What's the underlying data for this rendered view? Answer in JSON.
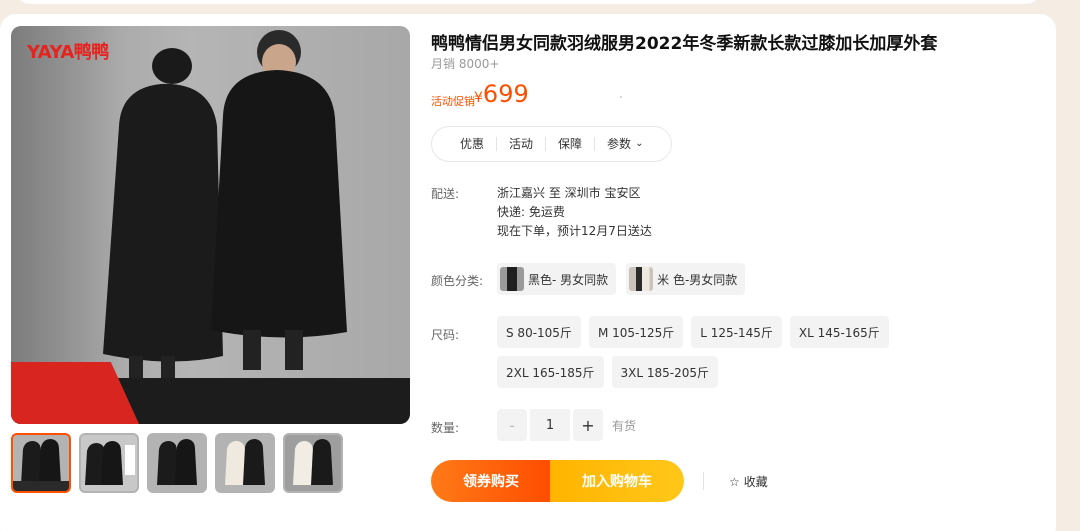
{
  "product": {
    "title": "鸭鸭情侣男女同款羽绒服男2022年冬季新款长款过膝加长加厚外套",
    "sales": "月销 8000+",
    "promo_label": "活动促销",
    "currency": "¥",
    "price": "699",
    "brand_logo": "YAYA鸭鸭"
  },
  "tabs": [
    {
      "label": "优惠"
    },
    {
      "label": "活动"
    },
    {
      "label": "保障"
    },
    {
      "label": "参数"
    }
  ],
  "shipping": {
    "label": "配送:",
    "route": "浙江嘉兴 至 深圳市 宝安区",
    "express": "快递: 免运费",
    "eta": "现在下单，预计12月7日送达"
  },
  "color": {
    "label": "颜色分类:",
    "options": [
      {
        "label": "黑色- 男女同款"
      },
      {
        "label": "米 色-男女同款"
      }
    ]
  },
  "size": {
    "label": "尺码:",
    "options": [
      {
        "label": "S 80-105斤"
      },
      {
        "label": "M 105-125斤"
      },
      {
        "label": "L 125-145斤"
      },
      {
        "label": "XL 145-165斤"
      },
      {
        "label": "2XL 165-185斤"
      },
      {
        "label": "3XL 185-205斤"
      }
    ]
  },
  "quantity": {
    "label": "数量:",
    "minus": "-",
    "value": "1",
    "plus": "+",
    "stock": "有货"
  },
  "actions": {
    "buy": "领券购买",
    "cart": "加入购物车",
    "favorite": "收藏"
  },
  "thumbnails_count": 5,
  "colors": {
    "accent": "#ff5000",
    "buy_start": "#ff7a18",
    "cart_start": "#ffb400"
  }
}
